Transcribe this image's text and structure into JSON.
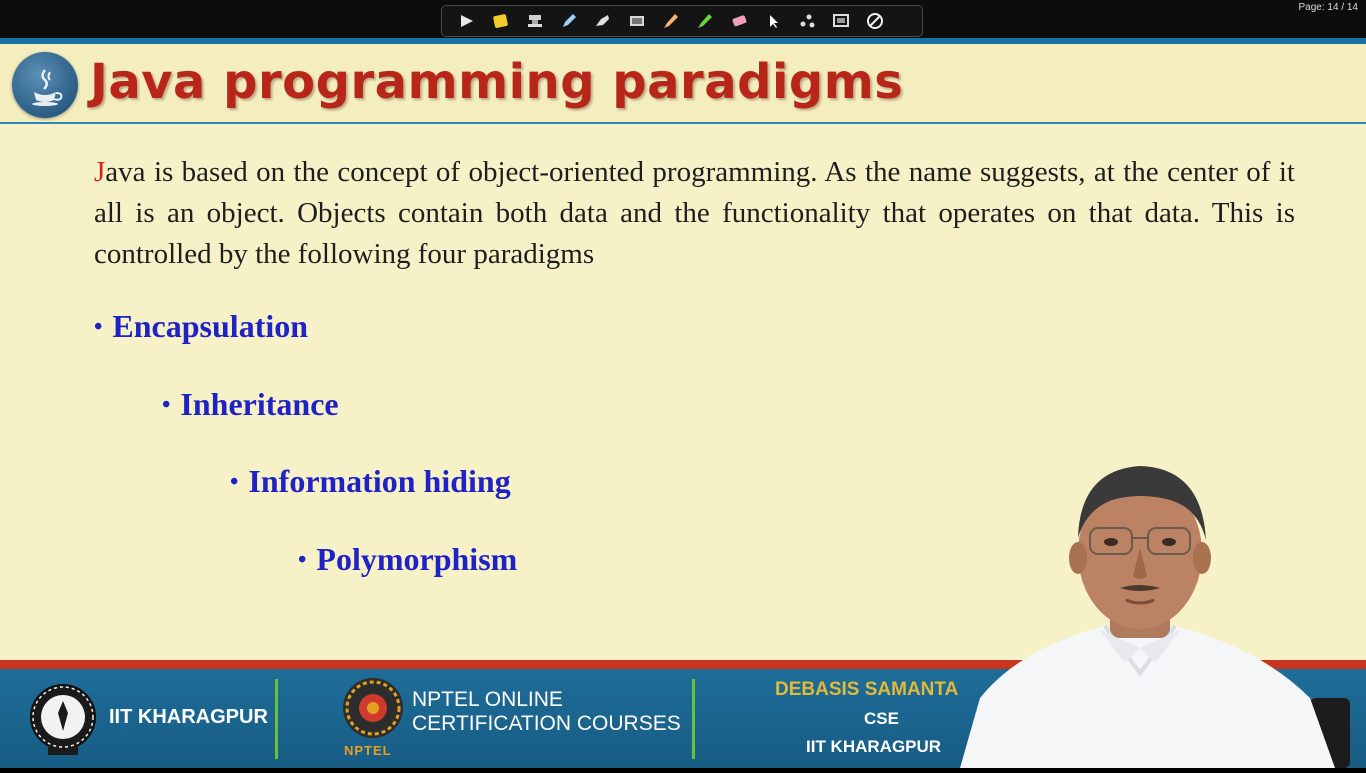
{
  "toolbar": {
    "page_counter": "Page: 14 / 14",
    "tools": [
      {
        "name": "pointer-arrow-icon"
      },
      {
        "name": "sticky-note-icon"
      },
      {
        "name": "stamp-icon"
      },
      {
        "name": "pen-icon"
      },
      {
        "name": "marker-icon"
      },
      {
        "name": "screen-icon"
      },
      {
        "name": "highlighter-icon"
      },
      {
        "name": "green-highlighter-icon"
      },
      {
        "name": "eraser-icon"
      },
      {
        "name": "cursor-icon"
      },
      {
        "name": "laser-dots-icon"
      },
      {
        "name": "whiteboard-icon"
      },
      {
        "name": "close-icon"
      }
    ]
  },
  "slide": {
    "title": "Java programming paradigms",
    "paragraph_first_letter": "J",
    "paragraph_rest": "ava is based on the concept of object-oriented programming. As the name suggests, at the center of it all is an object. Objects contain both data and the functionality that operates on that data. This is controlled by the following four paradigms",
    "bullets": [
      "Encapsulation",
      "Inheritance",
      "Information hiding",
      "Polymorphism"
    ]
  },
  "footer": {
    "institute": "IIT KHARAGPUR",
    "nptel_line1": "NPTEL ONLINE",
    "nptel_line2": "CERTIFICATION COURSES",
    "nptel_small": "NPTEL",
    "presenter_name": "DEBASIS SAMANTA",
    "presenter_dept": "CSE",
    "presenter_institute": "IIT KHARAGPUR"
  },
  "colors": {
    "title": "#b8261a",
    "bullet": "#1f22c4",
    "slide_bg": "#f7f1c8",
    "footer_bg": "#1e6d99",
    "footer_accent": "#c7341f",
    "divider": "#6abf3b"
  }
}
